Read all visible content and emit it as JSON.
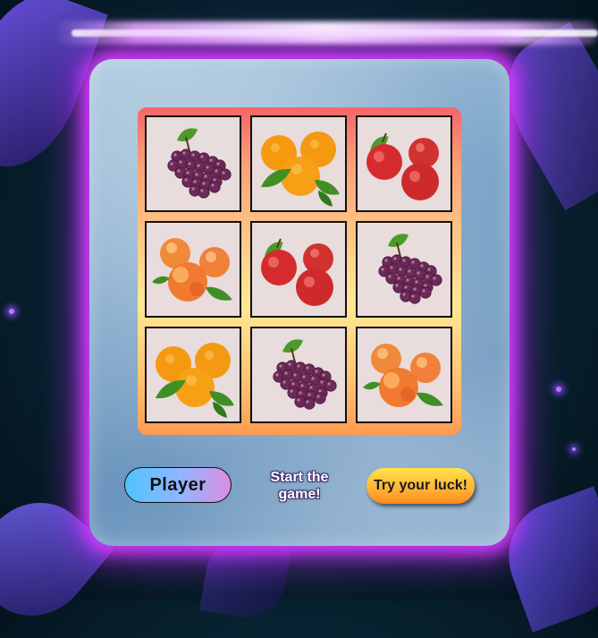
{
  "game": {
    "player_label": "Player",
    "status_text": "Start the game!",
    "action_label": "Try your luck!"
  },
  "board": {
    "rows": 3,
    "cols": 3,
    "cells": [
      [
        "grapes",
        "oranges",
        "apples"
      ],
      [
        "peaches",
        "apples",
        "grapes"
      ],
      [
        "oranges",
        "grapes",
        "peaches"
      ]
    ]
  },
  "colors": {
    "neon": "#d33cff",
    "board_top": "#f5656a",
    "board_bottom": "#ff9a4f",
    "player_gradient_start": "#4fc3ff",
    "player_gradient_end": "#d98fe0",
    "action_gradient_start": "#ffe24a",
    "action_gradient_end": "#ff8a1f"
  }
}
